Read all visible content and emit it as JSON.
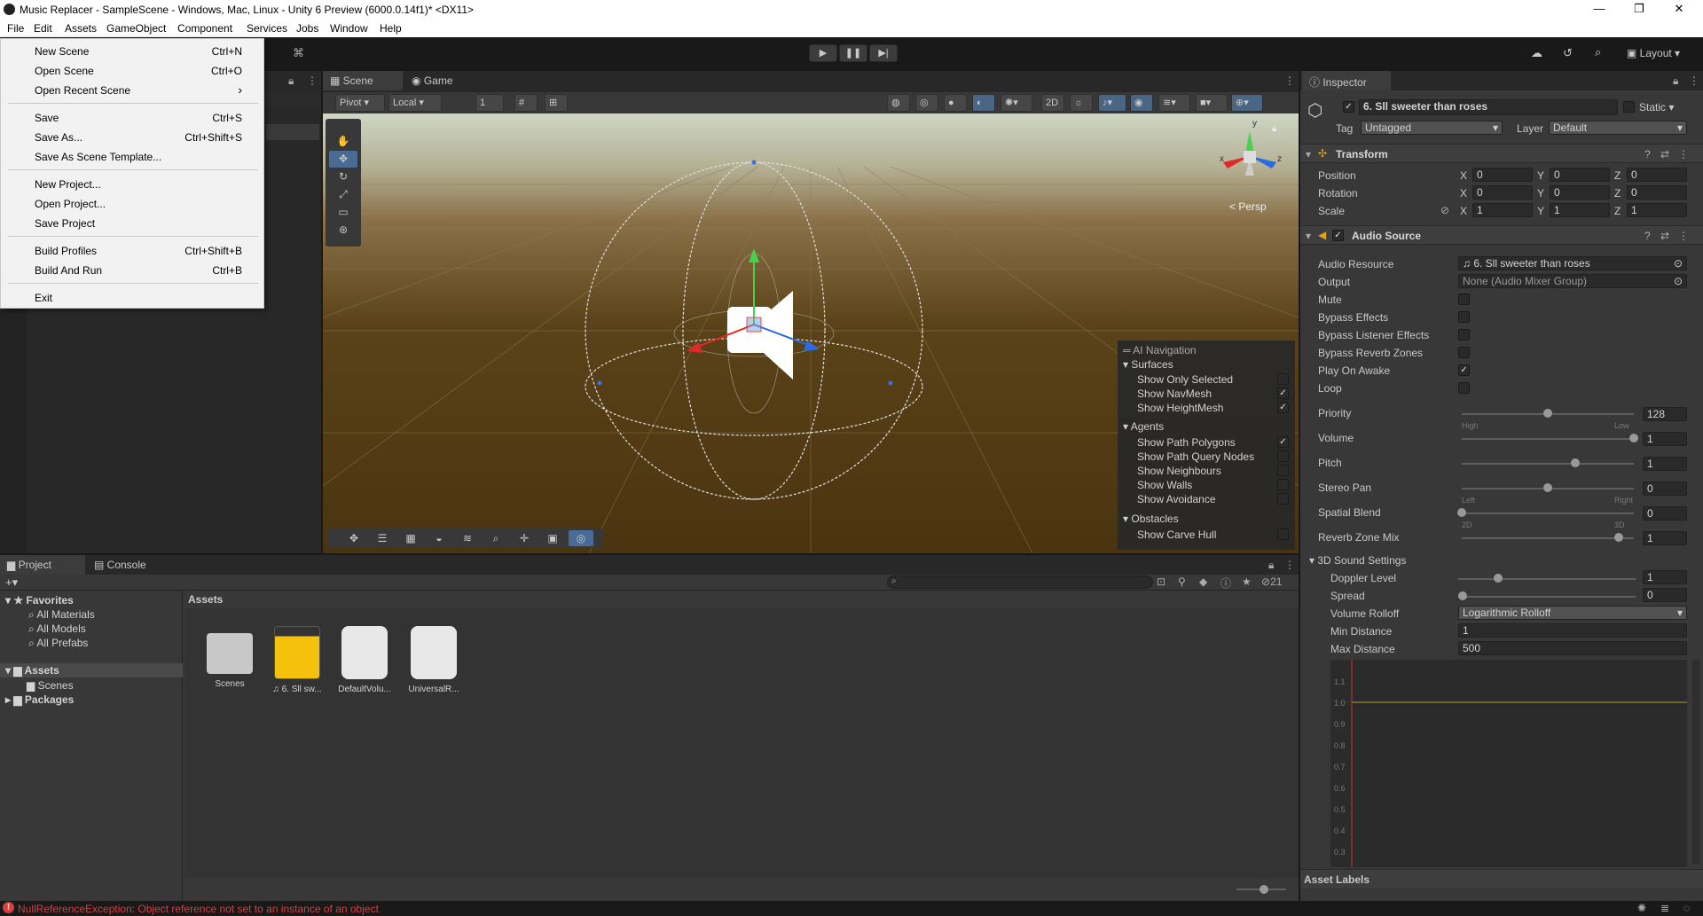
{
  "window": {
    "title": "Music Replacer - SampleScene - Windows, Mac, Linux - Unity 6 Preview (6000.0.14f1)* <DX11>",
    "controls": [
      "—",
      "❐",
      "✕"
    ]
  },
  "menubar": [
    "File",
    "Edit",
    "Assets",
    "GameObject",
    "Component",
    "Services",
    "Jobs",
    "Window",
    "Help"
  ],
  "file_menu": {
    "items": [
      {
        "label": "New Scene",
        "shortcut": "Ctrl+N"
      },
      {
        "label": "Open Scene",
        "shortcut": "Ctrl+O"
      },
      {
        "label": "Open Recent Scene",
        "shortcut": "›"
      },
      {
        "label": "Save",
        "shortcut": "Ctrl+S"
      },
      {
        "label": "Save As...",
        "shortcut": "Ctrl+Shift+S"
      },
      {
        "label": "Save As Scene Template...",
        "shortcut": ""
      },
      {
        "label": "New Project...",
        "shortcut": ""
      },
      {
        "label": "Open Project...",
        "shortcut": ""
      },
      {
        "label": "Save Project",
        "shortcut": ""
      },
      {
        "label": "Build Profiles",
        "shortcut": "Ctrl+Shift+B"
      },
      {
        "label": "Build And Run",
        "shortcut": "Ctrl+B"
      },
      {
        "label": "Exit",
        "shortcut": ""
      }
    ]
  },
  "toolbar": {
    "layout_label": "Layout"
  },
  "scene_panel": {
    "tabs": [
      "Scene",
      "Game"
    ],
    "pivot": "Pivot",
    "local": "Local",
    "grid_value": "1",
    "persp_label": "< Persp",
    "gizmo_axes": {
      "y": "y",
      "x": "x",
      "z": "z"
    }
  },
  "ai_navigation": {
    "title": "AI Navigation",
    "sections": [
      {
        "name": "Surfaces",
        "items": [
          {
            "label": "Show Only Selected",
            "checked": false
          },
          {
            "label": "Show NavMesh",
            "checked": true
          },
          {
            "label": "Show HeightMesh",
            "checked": true
          }
        ]
      },
      {
        "name": "Agents",
        "items": [
          {
            "label": "Show Path Polygons",
            "checked": true
          },
          {
            "label": "Show Path Query Nodes",
            "checked": false
          },
          {
            "label": "Show Neighbours",
            "checked": false
          },
          {
            "label": "Show Walls",
            "checked": false
          },
          {
            "label": "Show Avoidance",
            "checked": false
          }
        ]
      },
      {
        "name": "Obstacles",
        "items": [
          {
            "label": "Show Carve Hull",
            "checked": false
          }
        ]
      }
    ]
  },
  "project_panel": {
    "tabs": [
      "Project",
      "Console"
    ],
    "hidden_count": "21",
    "tree": {
      "favorites": "Favorites",
      "favorites_items": [
        "All Materials",
        "All Models",
        "All Prefabs"
      ],
      "assets": "Assets",
      "scenes": "Scenes",
      "packages": "Packages"
    },
    "breadcrumb": "Assets",
    "assets": [
      {
        "label": "Scenes",
        "kind": "folder"
      },
      {
        "label": "♫ 6. Sll sw...",
        "kind": "audio"
      },
      {
        "label": "DefaultVolu...",
        "kind": "volume"
      },
      {
        "label": "UniversalR...",
        "kind": "settings"
      }
    ]
  },
  "inspector": {
    "tab": "Inspector",
    "object_name": "6. Sll sweeter than roses",
    "static_label": "Static",
    "tag_label": "Tag",
    "tag_value": "Untagged",
    "layer_label": "Layer",
    "layer_value": "Default",
    "transform": {
      "title": "Transform",
      "rows": [
        {
          "label": "Position",
          "x": "0",
          "y": "0",
          "z": "0"
        },
        {
          "label": "Rotation",
          "x": "0",
          "y": "0",
          "z": "0"
        },
        {
          "label": "Scale",
          "x": "1",
          "y": "1",
          "z": "1"
        }
      ],
      "axis_labels": [
        "X",
        "Y",
        "Z"
      ]
    },
    "audio_source": {
      "title": "Audio Source",
      "audio_resource_label": "Audio Resource",
      "audio_resource_value": "♫ 6. Sll sweeter than roses",
      "output_label": "Output",
      "output_value": "None (Audio Mixer Group)",
      "toggles": [
        {
          "label": "Mute",
          "checked": false
        },
        {
          "label": "Bypass Effects",
          "checked": false
        },
        {
          "label": "Bypass Listener Effects",
          "checked": false
        },
        {
          "label": "Bypass Reverb Zones",
          "checked": false
        },
        {
          "label": "Play On Awake",
          "checked": true
        },
        {
          "label": "Loop",
          "checked": false
        }
      ],
      "sliders": [
        {
          "label": "Priority",
          "value": "128",
          "pos": 0.5,
          "left": "High",
          "right": "Low"
        },
        {
          "label": "Volume",
          "value": "1",
          "pos": 1.0,
          "left": "",
          "right": ""
        },
        {
          "label": "Pitch",
          "value": "1",
          "pos": 0.66,
          "left": "",
          "right": ""
        },
        {
          "label": "Stereo Pan",
          "value": "0",
          "pos": 0.5,
          "left": "Left",
          "right": "Right"
        },
        {
          "label": "Spatial Blend",
          "value": "0",
          "pos": 0.0,
          "left": "2D",
          "right": "3D"
        },
        {
          "label": "Reverb Zone Mix",
          "value": "1",
          "pos": 0.91,
          "left": "",
          "right": ""
        }
      ],
      "sound3d_title": "3D Sound Settings",
      "doppler_label": "Doppler Level",
      "doppler_value": "1",
      "spread_label": "Spread",
      "spread_value": "0",
      "rolloff_label": "Volume Rolloff",
      "rolloff_value": "Logarithmic Rolloff",
      "min_distance_label": "Min Distance",
      "min_distance_value": "1",
      "max_distance_label": "Max Distance",
      "max_distance_value": "500",
      "curve_y_ticks": [
        "1.1",
        "1.0",
        "0.9",
        "0.8",
        "0.7",
        "0.6",
        "0.5",
        "0.4",
        "0.3"
      ]
    },
    "asset_labels": "Asset Labels"
  },
  "status": {
    "error_message": "NullReferenceException: Object reference not set to an instance of an object"
  },
  "colors": {
    "accent_blue": "#4a6b96",
    "error_red": "#d44040",
    "scene_ground": "#4a3410"
  }
}
